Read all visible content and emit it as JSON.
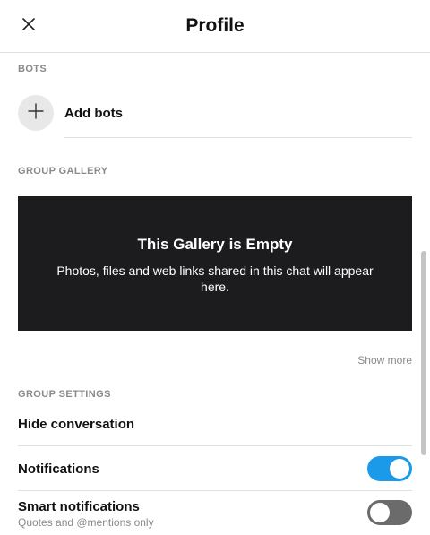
{
  "header": {
    "title": "Profile",
    "close_icon": "close-icon"
  },
  "bots": {
    "section_label": "BOTS",
    "add_label": "Add bots",
    "add_icon": "plus-icon"
  },
  "gallery": {
    "section_label": "GROUP GALLERY",
    "empty_title": "This Gallery is Empty",
    "empty_text": "Photos, files and web links shared in this chat will appear here.",
    "show_more_label": "Show more"
  },
  "settings": {
    "section_label": "GROUP SETTINGS",
    "hide_conversation_label": "Hide conversation",
    "notifications_label": "Notifications",
    "notifications_enabled": true,
    "smart_notifications_label": "Smart notifications",
    "smart_notifications_sub": "Quotes and @mentions only",
    "smart_notifications_enabled": false
  },
  "colors": {
    "toggle_on": "#1a9ae8",
    "toggle_off": "#6b6b6b",
    "gallery_bg": "#1c1c1e"
  }
}
